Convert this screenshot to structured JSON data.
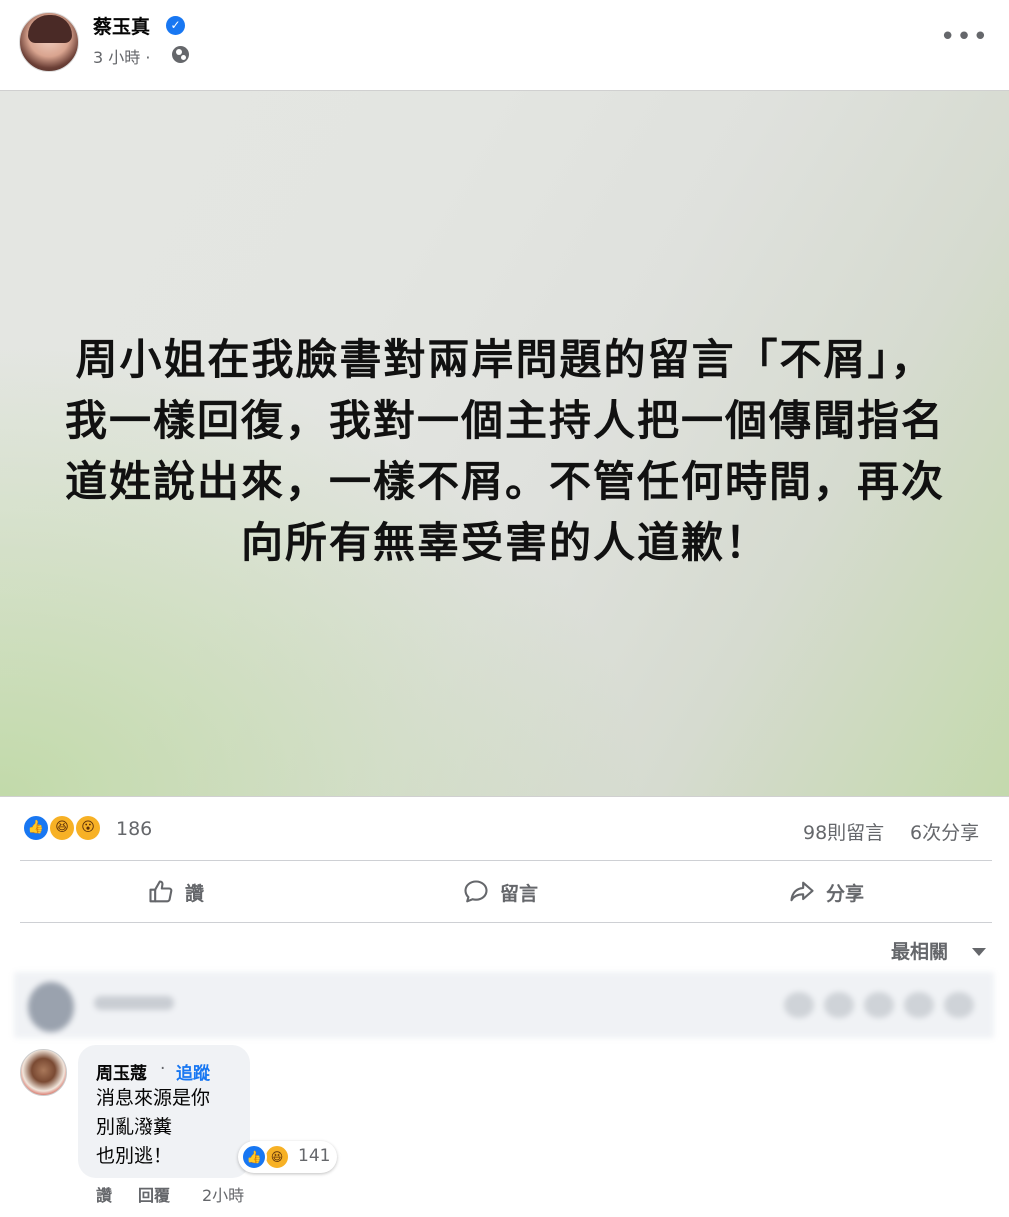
{
  "post": {
    "author": "蔡玉真",
    "time": "3 小時 ·",
    "image_text_lines": [
      "周小姐在我臉書對兩岸問題的留言「不屑」，",
      "我一樣回復，我對一個主持人把一個傳聞指名",
      "道姓說出來，一樣不屑。不管任何時間，再次",
      "向所有無辜受害的人道歉！"
    ]
  },
  "stats": {
    "reaction_count": "186",
    "comments": "98則留言",
    "shares": "6次分享"
  },
  "actions": {
    "like": "讚",
    "comment": "留言",
    "share": "分享"
  },
  "sort": {
    "label": "最相關"
  },
  "comment": {
    "name": "周玉蔻",
    "dot": "·",
    "follow": "追蹤",
    "lines": [
      "消息來源是你",
      "別亂潑糞",
      "也別逃！"
    ],
    "reaction_count": "141",
    "like": "讚",
    "reply": "回覆",
    "time": "2小時"
  },
  "colors": {
    "accent": "#1877f2",
    "secondary_text": "#65676b",
    "bubble": "#f0f2f5"
  },
  "icons": [
    "verified-icon",
    "globe-icon",
    "more-icon",
    "like-icon",
    "comment-icon",
    "share-icon",
    "caret-down-icon",
    "haha-icon",
    "wow-icon"
  ]
}
